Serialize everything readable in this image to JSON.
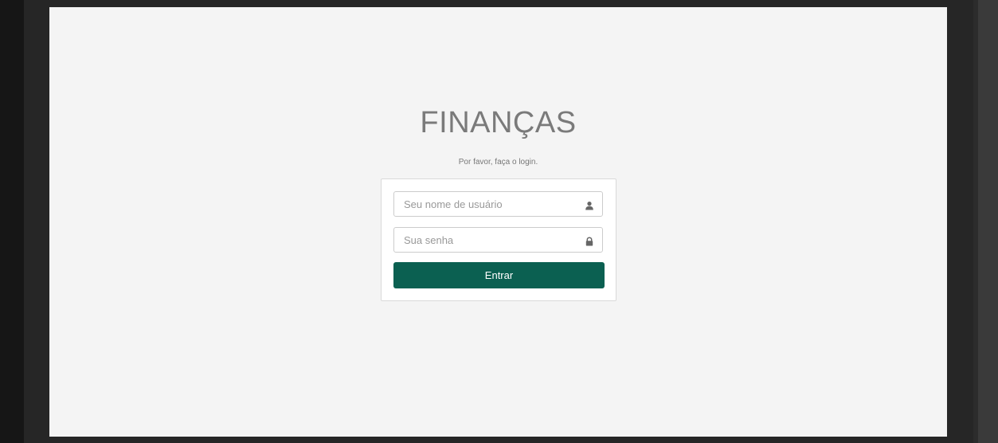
{
  "app": {
    "title": "FINANÇAS",
    "subtitle": "Por favor, faça o login."
  },
  "login": {
    "username_placeholder": "Seu nome de usuário",
    "username_icon": "user-icon",
    "password_placeholder": "Sua senha",
    "password_icon": "lock-icon",
    "submit_label": "Entrar"
  },
  "colors": {
    "brand": "#0b6051",
    "page_background": "#f4f4f4",
    "title_text": "#7a7a7a"
  }
}
